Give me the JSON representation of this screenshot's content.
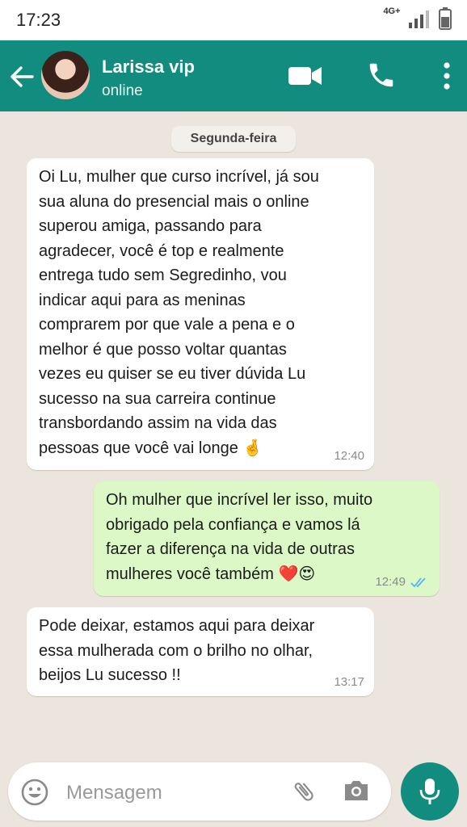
{
  "status_bar": {
    "time": "17:23",
    "network": "4G+"
  },
  "header": {
    "contact_name": "Larissa vip",
    "contact_status": "online"
  },
  "chat": {
    "date_label": "Segunda-feira",
    "messages": [
      {
        "direction": "incoming",
        "text": "Oi Lu, mulher que curso incrível, já sou\nsua aluna do presencial mais o online\nsuperou amiga, passando para\nagradecer, você é top e realmente\nentrega tudo sem Segredinho, vou\nindicar aqui para as meninas\ncomprarem por que vale a pena  e o\nmelhor é que posso voltar quantas\nvezes eu quiser se eu tiver dúvida Lu\nsucesso na sua carreira continue\ntransbordando assim na vida das\npessoas que você vai longe",
        "emoji": "🤞",
        "time": "12:40"
      },
      {
        "direction": "outgoing",
        "text": "Oh mulher que incrível ler isso, muito\nobrigado pela confiança e vamos lá\nfazer a diferença na vida de outras\nmulheres você também",
        "emoji": "❤️😍",
        "time": "12:49",
        "read": true
      },
      {
        "direction": "incoming",
        "text": "Pode deixar, estamos aqui para deixar\nessa mulherada com o brilho no olhar,\nbeijos Lu sucesso !!",
        "time": "13:17"
      }
    ]
  },
  "input": {
    "placeholder": "Mensagem"
  },
  "icons": [
    "back-arrow-icon",
    "video-call-icon",
    "phone-icon",
    "more-options-icon",
    "emoji-icon",
    "attach-icon",
    "camera-icon",
    "mic-icon",
    "double-check-icon"
  ],
  "colors": {
    "header": "#128c7e",
    "outgoing_bubble": "#dcf8c6",
    "incoming_bubble": "#ffffff",
    "chat_background": "#ece5dd",
    "read_ticks": "#4fb6ec"
  }
}
